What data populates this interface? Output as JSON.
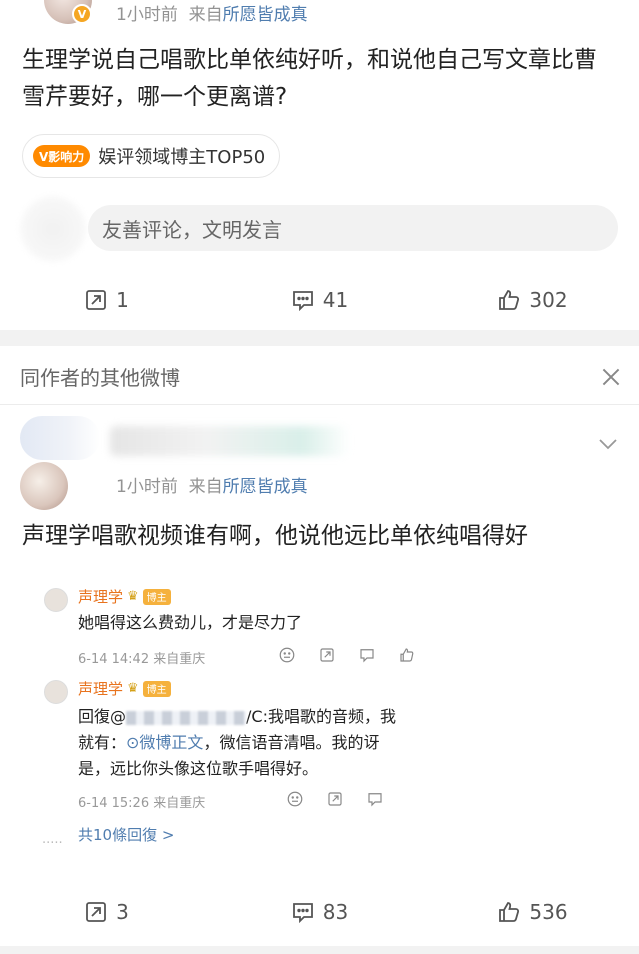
{
  "post1": {
    "time": "1小时前",
    "from": "来自",
    "source": "所愿皆成真",
    "text": "生理学说自己唱歌比单依纯好听，和说他自己写文章比曹雪芹要好，哪一个更离谱?",
    "influence_badge": "V影响力",
    "influence_label": "娱评领域博主TOP50",
    "comment_placeholder": "友善评论，文明发言",
    "reposts": "1",
    "comments": "41",
    "likes": "302"
  },
  "section": {
    "title": "同作者的其他微博"
  },
  "post2": {
    "time": "1小时前",
    "from": "来自",
    "source": "所愿皆成真",
    "text": "声理学唱歌视频谁有啊，他说他远比单依纯唱得好",
    "replies": [
      {
        "name": "声理学",
        "tag": "博主",
        "text": "她唱得这么费劲儿，才是尽力了",
        "meta": "6-14 14:42 来自重庆"
      },
      {
        "name": "声理学",
        "tag": "博主",
        "prefix": "回復@",
        "tail": "/C:我唱歌的音频，我",
        "line2a": "就有：",
        "link": "微博正文",
        "line2b": "，微信语音清唱。我的讶",
        "line3": "是，远比你头像这位歌手唱得好。",
        "meta": "6-14 15:26 来自重庆"
      }
    ],
    "more_replies": "共10條回復 >",
    "reposts": "3",
    "comments": "83",
    "likes": "536"
  },
  "colors": {
    "accent_link": "#507daf",
    "vip_orange": "#f5a623",
    "name_orange": "#e8731e",
    "separator": "#f2f2f2"
  },
  "icons": [
    "v-badge-icon",
    "repost-icon",
    "comment-icon",
    "like-icon",
    "close-icon",
    "chevron-down-icon",
    "emoji-icon",
    "share-icon",
    "reply-icon",
    "link-icon"
  ]
}
